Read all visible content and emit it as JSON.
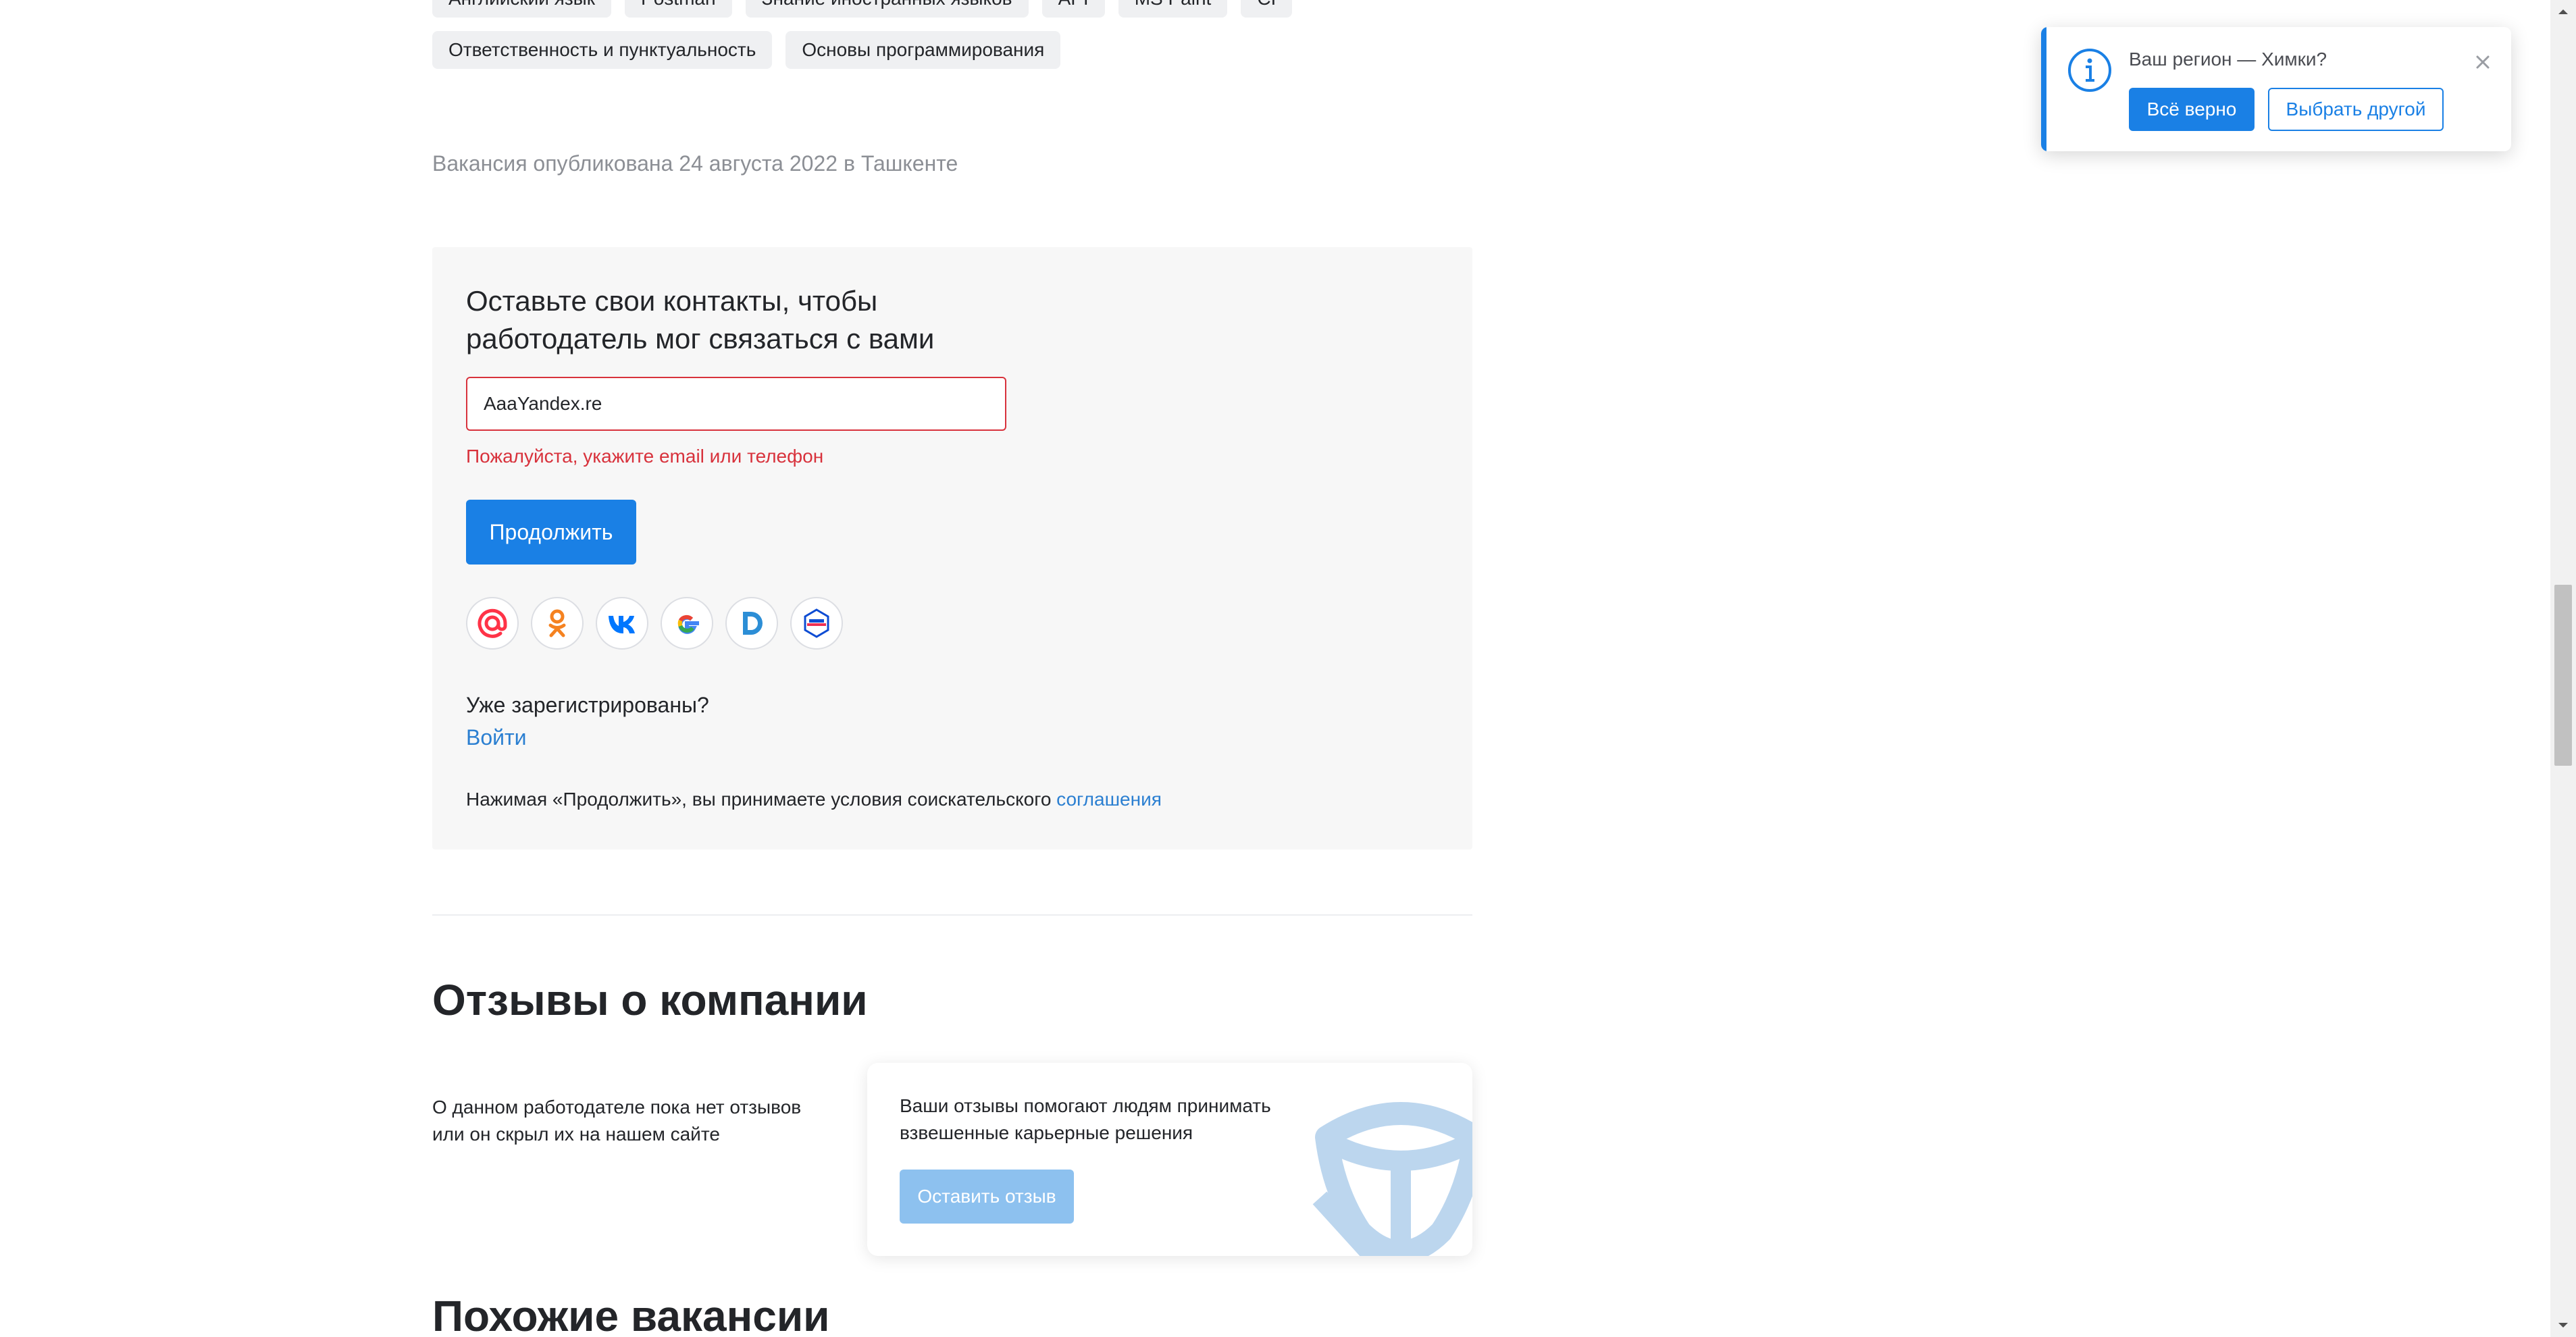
{
  "skills": {
    "row1": [
      "Английский язык",
      "Postman",
      "Знание иностранных языков",
      "API",
      "MS Paint",
      "CI"
    ],
    "row2": [
      "Ответственность и пунктуальность",
      "Основы программирования"
    ]
  },
  "published_text": "Вакансия опубликована 24 августа 2022 в Ташкенте",
  "contacts": {
    "title": "Оставьте свои контакты, чтобы работодатель мог связаться с вами",
    "input_value": "AaaYandex.re",
    "error": "Пожалуйста, укажите email или телефон",
    "continue_label": "Продолжить",
    "socials": [
      "mail-ru-icon",
      "odnoklassniki-icon",
      "vk-icon",
      "google-icon",
      "d-icon",
      "gosuslugi-icon"
    ],
    "registered_question": "Уже зарегистрированы?",
    "login_label": "Войти",
    "agreement_prefix": "Нажимая «Продолжить», вы принимаете условия соискательского",
    "agreement_link": "соглашения"
  },
  "reviews": {
    "title": "Отзывы о компании",
    "empty_text": "О данном работодателе пока нет отзывов или он скрыл их на нашем сайте",
    "card_text": "Ваши отзывы помогают людям принимать взвешенные карьерные решения",
    "leave_review_label": "Оставить отзыв"
  },
  "similar": {
    "title": "Похожие вакансии"
  },
  "region_popup": {
    "question": "Ваш регион — Химки?",
    "confirm_label": "Всё верно",
    "choose_other_label": "Выбрать другой"
  },
  "colors": {
    "accent": "#1a80e5",
    "error": "#d8323c",
    "link": "#2b7fd1",
    "panel_bg": "#f7f7f7"
  }
}
